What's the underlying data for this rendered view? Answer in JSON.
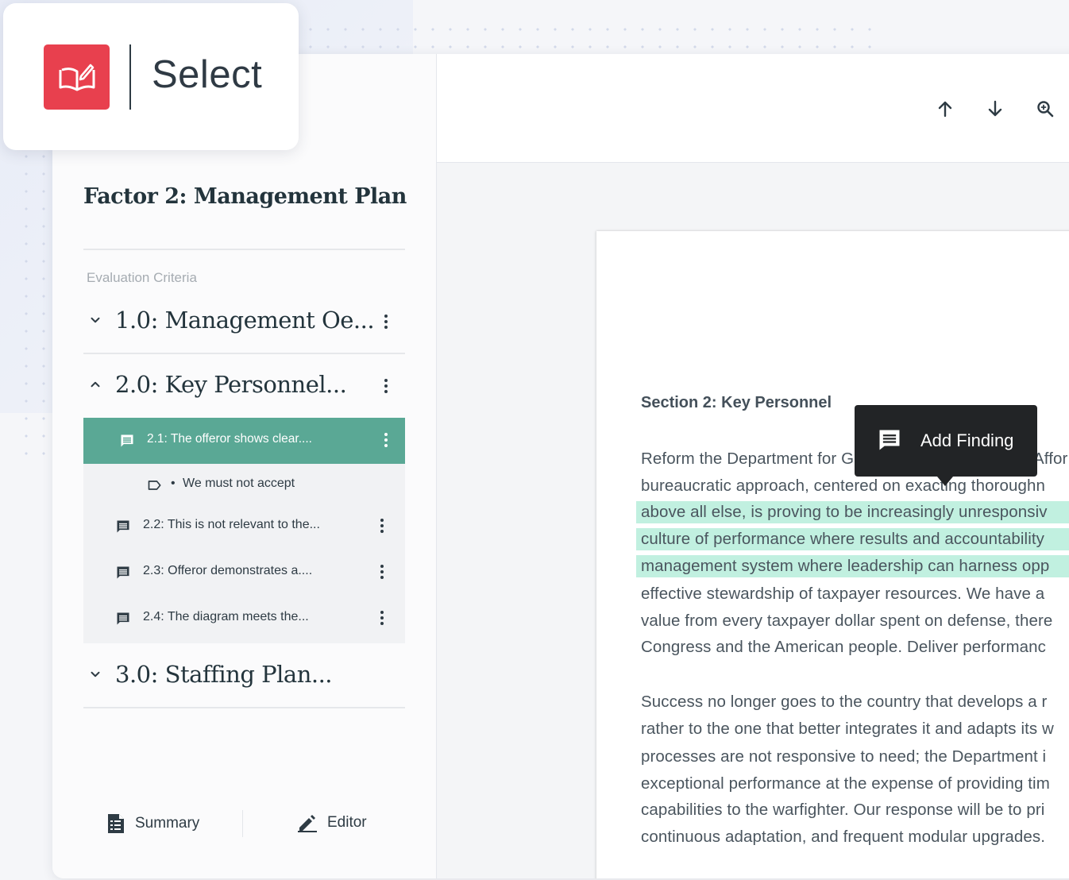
{
  "logo": {
    "text": "Select",
    "icon": "open-book-edit-icon",
    "color": "#e8404e"
  },
  "toolbar": {
    "prev_icon": "arrow-up-icon",
    "next_icon": "arrow-down-icon",
    "search_icon": "search-icon"
  },
  "sidebar": {
    "factor_title": "Factor 2: Management Plan",
    "section_label": "Evaluation Criteria",
    "criteria": [
      {
        "label": "1.0: Management Oe...",
        "expanded": false
      },
      {
        "label": "2.0: Key Personnel...",
        "expanded": true
      },
      {
        "label": "3.0: Staffing Plan...",
        "expanded": false
      }
    ],
    "subitems": [
      {
        "label": "2.1: The offeror shows clear....",
        "active": true,
        "icon": "comment-icon"
      },
      {
        "label": "We must not accept",
        "type": "tag",
        "bullet": "•",
        "icon": "tag-icon"
      },
      {
        "label": "2.2: This is not relevant to the...",
        "icon": "comment-icon"
      },
      {
        "label": "2.3: Offeror demonstrates a....",
        "icon": "comment-icon"
      },
      {
        "label": "2.4: The diagram meets the...",
        "icon": "comment-icon"
      }
    ],
    "footer": {
      "summary_label": "Summary",
      "summary_icon": "document-list-icon",
      "editor_label": "Editor",
      "editor_icon": "pencil-icon"
    },
    "accent_color": "#5aa895"
  },
  "document": {
    "section_title": "Section 2: Key Personnel",
    "paragraph1": [
      "Reform the Department for G",
      "bureaucratic approach, centered on exacting thoroughn",
      "above all else, is proving to be increasingly unresponsiv",
      "culture of performance where results and accountability",
      "management system where leadership can harness opp",
      "effective stewardship of taxpayer resources. We have a",
      "value from every taxpayer dollar spent on defense, there",
      "Congress and the American people. Deliver performanc"
    ],
    "paragraph1_line1_tail": "Affor",
    "paragraph2": [
      "Success no longer goes to the country that develops a r",
      "rather to the one that better integrates it and adapts its w",
      "processes are not responsive to need; the Department i",
      "exceptional performance at the expense of providing tim",
      "capabilities to the warfighter. Our response will be to pri",
      "continuous adaptation, and frequent modular upgrades."
    ],
    "highlight_color": "#c1f0e0"
  },
  "tooltip": {
    "label": "Add Finding",
    "icon": "comment-icon"
  }
}
